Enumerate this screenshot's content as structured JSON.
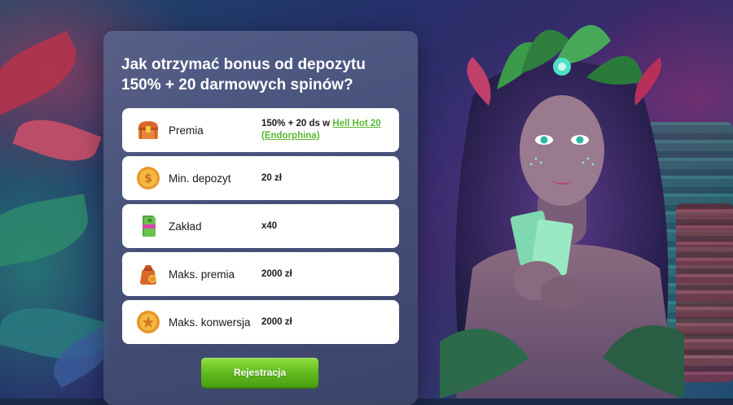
{
  "promo": {
    "title": "Jak otrzymać bonus od depozytu 150% + 20 darmowych spinów?",
    "rows": [
      {
        "icon": "treasure-chest-icon",
        "label": "Premia",
        "value_prefix": "150% + 20 ds w ",
        "value_link": "Hell Hot 20 (Endorphina)"
      },
      {
        "icon": "gold-coin-icon",
        "label": "Min. depozyt",
        "value": "20 zł"
      },
      {
        "icon": "cash-stack-icon",
        "label": "Zakład",
        "value": "x40"
      },
      {
        "icon": "money-bag-icon",
        "label": "Maks. premia",
        "value": "2000 zł"
      },
      {
        "icon": "coin-icon",
        "label": "Maks. konwersja",
        "value": "2000 zł"
      }
    ],
    "register_label": "Rejestracja"
  },
  "colors": {
    "accent_green": "#5ab832",
    "button_green": "#6cc52a",
    "panel": "#5a648c"
  }
}
